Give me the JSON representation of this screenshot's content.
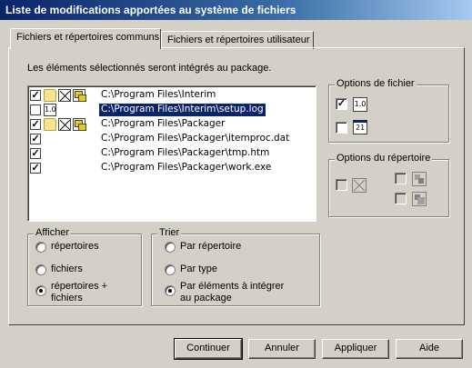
{
  "window": {
    "title": "Liste de modifications apportées au système de fichiers"
  },
  "tabs": [
    {
      "label": "Fichiers et répertoires communs",
      "active": true
    },
    {
      "label": "Fichiers et répertoires utilisateur",
      "active": false
    }
  ],
  "description": "Les éléments sélectionnés seront intégrés au package.",
  "file_list": [
    {
      "checked": true,
      "icons": [
        "folder-icon",
        "x-box-icon",
        "double-box-icon"
      ],
      "path": "C:\\Program Files\\Interim",
      "selected": false
    },
    {
      "checked": false,
      "icons": [
        "ten-box-icon"
      ],
      "ten_label": "1.0",
      "path": "C:\\Program Files\\Interim\\setup.log",
      "selected": true
    },
    {
      "checked": true,
      "icons": [
        "folder-icon",
        "x-box-icon",
        "double-box-icon"
      ],
      "path": "C:\\Program Files\\Packager",
      "selected": false
    },
    {
      "checked": true,
      "icons": [],
      "path": "C:\\Program Files\\Packager\\itemproc.dat",
      "selected": false
    },
    {
      "checked": true,
      "icons": [],
      "path": "C:\\Program Files\\Packager\\tmp.htm",
      "selected": false
    },
    {
      "checked": true,
      "icons": [],
      "path": "C:\\Program Files\\Packager\\work.exe",
      "selected": false
    }
  ],
  "file_options": {
    "title": "Options de fichier",
    "ten_label": "1.0",
    "calendar_label": "21"
  },
  "directory_options": {
    "title": "Options du répertoire"
  },
  "display": {
    "title": "Afficher",
    "options": [
      "répertoires",
      "fichiers",
      "répertoires +",
      "fichiers"
    ],
    "selected": 2
  },
  "sort": {
    "title": "Trier",
    "options": [
      "Par répertoire",
      "Par type",
      "Par éléments à intégrer",
      "au package"
    ],
    "selected": 2
  },
  "buttons": {
    "continue": "Continuer",
    "cancel": "Annuler",
    "apply": "Appliquer",
    "help": "Aide"
  }
}
